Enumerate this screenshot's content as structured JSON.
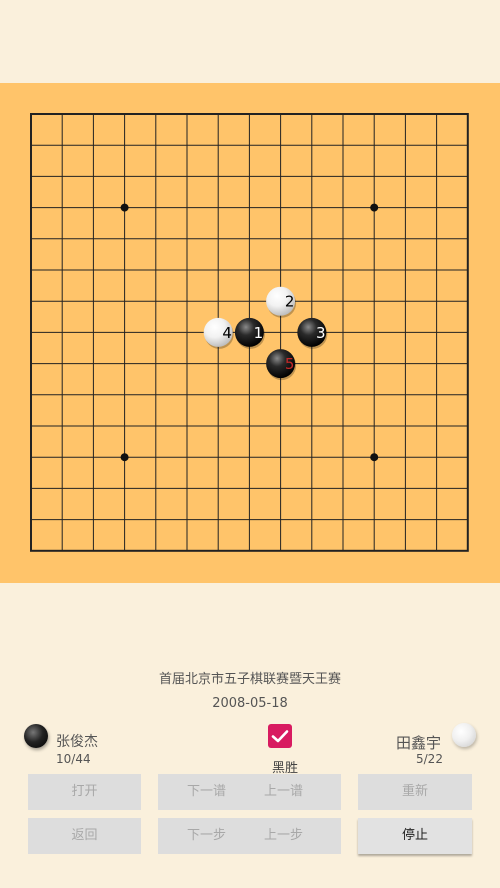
{
  "board": {
    "size": 15,
    "background": "#ffc46a",
    "star_points": [
      [
        3,
        3
      ],
      [
        11,
        3
      ],
      [
        3,
        11
      ],
      [
        11,
        11
      ]
    ],
    "moves": [
      {
        "n": "1",
        "color": "black",
        "col": 7,
        "row": 7
      },
      {
        "n": "2",
        "color": "white",
        "col": 8,
        "row": 6
      },
      {
        "n": "3",
        "color": "black",
        "col": 9,
        "row": 7
      },
      {
        "n": "4",
        "color": "white",
        "col": 6,
        "row": 7
      },
      {
        "n": "5",
        "color": "black",
        "col": 8,
        "row": 8
      }
    ],
    "last_move_number_color": "#c62828"
  },
  "game": {
    "title": "首届北京市五子棋联赛暨天王赛",
    "date": "2008-05-18",
    "result": "黑胜",
    "result_checked": true
  },
  "players": {
    "black": {
      "name": "张俊杰",
      "score": "10/44",
      "stone": "black-stone-icon"
    },
    "white": {
      "name": "田鑫宇",
      "score": "5/22",
      "stone": "white-stone-icon"
    }
  },
  "buttons": {
    "open": "打开",
    "next_game_partial": "下一谱",
    "prev_game": "上一谱",
    "refresh": "重新",
    "back": "返回",
    "next_step_partial": "下一步",
    "prev_step": "上一步",
    "stop": "停止"
  },
  "colors": {
    "accent": "#d81b60",
    "page_bg": "#faf0dc"
  }
}
